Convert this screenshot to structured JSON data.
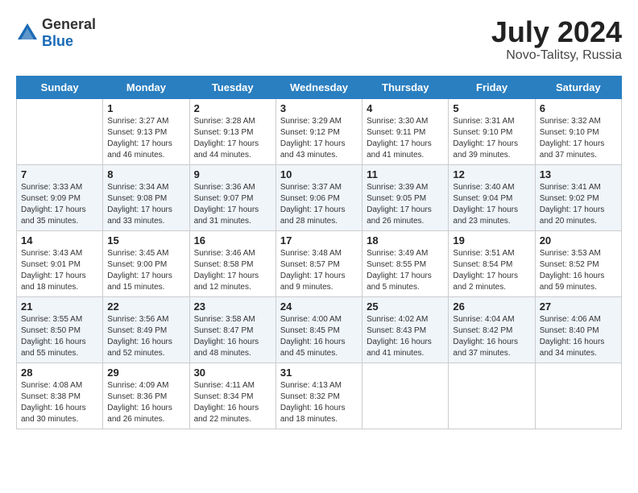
{
  "logo": {
    "general": "General",
    "blue": "Blue"
  },
  "title": "July 2024",
  "location": "Novo-Talitsy, Russia",
  "weekdays": [
    "Sunday",
    "Monday",
    "Tuesday",
    "Wednesday",
    "Thursday",
    "Friday",
    "Saturday"
  ],
  "weeks": [
    [
      {
        "day": "",
        "info": ""
      },
      {
        "day": "1",
        "info": "Sunrise: 3:27 AM\nSunset: 9:13 PM\nDaylight: 17 hours\nand 46 minutes."
      },
      {
        "day": "2",
        "info": "Sunrise: 3:28 AM\nSunset: 9:13 PM\nDaylight: 17 hours\nand 44 minutes."
      },
      {
        "day": "3",
        "info": "Sunrise: 3:29 AM\nSunset: 9:12 PM\nDaylight: 17 hours\nand 43 minutes."
      },
      {
        "day": "4",
        "info": "Sunrise: 3:30 AM\nSunset: 9:11 PM\nDaylight: 17 hours\nand 41 minutes."
      },
      {
        "day": "5",
        "info": "Sunrise: 3:31 AM\nSunset: 9:10 PM\nDaylight: 17 hours\nand 39 minutes."
      },
      {
        "day": "6",
        "info": "Sunrise: 3:32 AM\nSunset: 9:10 PM\nDaylight: 17 hours\nand 37 minutes."
      }
    ],
    [
      {
        "day": "7",
        "info": "Sunrise: 3:33 AM\nSunset: 9:09 PM\nDaylight: 17 hours\nand 35 minutes."
      },
      {
        "day": "8",
        "info": "Sunrise: 3:34 AM\nSunset: 9:08 PM\nDaylight: 17 hours\nand 33 minutes."
      },
      {
        "day": "9",
        "info": "Sunrise: 3:36 AM\nSunset: 9:07 PM\nDaylight: 17 hours\nand 31 minutes."
      },
      {
        "day": "10",
        "info": "Sunrise: 3:37 AM\nSunset: 9:06 PM\nDaylight: 17 hours\nand 28 minutes."
      },
      {
        "day": "11",
        "info": "Sunrise: 3:39 AM\nSunset: 9:05 PM\nDaylight: 17 hours\nand 26 minutes."
      },
      {
        "day": "12",
        "info": "Sunrise: 3:40 AM\nSunset: 9:04 PM\nDaylight: 17 hours\nand 23 minutes."
      },
      {
        "day": "13",
        "info": "Sunrise: 3:41 AM\nSunset: 9:02 PM\nDaylight: 17 hours\nand 20 minutes."
      }
    ],
    [
      {
        "day": "14",
        "info": "Sunrise: 3:43 AM\nSunset: 9:01 PM\nDaylight: 17 hours\nand 18 minutes."
      },
      {
        "day": "15",
        "info": "Sunrise: 3:45 AM\nSunset: 9:00 PM\nDaylight: 17 hours\nand 15 minutes."
      },
      {
        "day": "16",
        "info": "Sunrise: 3:46 AM\nSunset: 8:58 PM\nDaylight: 17 hours\nand 12 minutes."
      },
      {
        "day": "17",
        "info": "Sunrise: 3:48 AM\nSunset: 8:57 PM\nDaylight: 17 hours\nand 9 minutes."
      },
      {
        "day": "18",
        "info": "Sunrise: 3:49 AM\nSunset: 8:55 PM\nDaylight: 17 hours\nand 5 minutes."
      },
      {
        "day": "19",
        "info": "Sunrise: 3:51 AM\nSunset: 8:54 PM\nDaylight: 17 hours\nand 2 minutes."
      },
      {
        "day": "20",
        "info": "Sunrise: 3:53 AM\nSunset: 8:52 PM\nDaylight: 16 hours\nand 59 minutes."
      }
    ],
    [
      {
        "day": "21",
        "info": "Sunrise: 3:55 AM\nSunset: 8:50 PM\nDaylight: 16 hours\nand 55 minutes."
      },
      {
        "day": "22",
        "info": "Sunrise: 3:56 AM\nSunset: 8:49 PM\nDaylight: 16 hours\nand 52 minutes."
      },
      {
        "day": "23",
        "info": "Sunrise: 3:58 AM\nSunset: 8:47 PM\nDaylight: 16 hours\nand 48 minutes."
      },
      {
        "day": "24",
        "info": "Sunrise: 4:00 AM\nSunset: 8:45 PM\nDaylight: 16 hours\nand 45 minutes."
      },
      {
        "day": "25",
        "info": "Sunrise: 4:02 AM\nSunset: 8:43 PM\nDaylight: 16 hours\nand 41 minutes."
      },
      {
        "day": "26",
        "info": "Sunrise: 4:04 AM\nSunset: 8:42 PM\nDaylight: 16 hours\nand 37 minutes."
      },
      {
        "day": "27",
        "info": "Sunrise: 4:06 AM\nSunset: 8:40 PM\nDaylight: 16 hours\nand 34 minutes."
      }
    ],
    [
      {
        "day": "28",
        "info": "Sunrise: 4:08 AM\nSunset: 8:38 PM\nDaylight: 16 hours\nand 30 minutes."
      },
      {
        "day": "29",
        "info": "Sunrise: 4:09 AM\nSunset: 8:36 PM\nDaylight: 16 hours\nand 26 minutes."
      },
      {
        "day": "30",
        "info": "Sunrise: 4:11 AM\nSunset: 8:34 PM\nDaylight: 16 hours\nand 22 minutes."
      },
      {
        "day": "31",
        "info": "Sunrise: 4:13 AM\nSunset: 8:32 PM\nDaylight: 16 hours\nand 18 minutes."
      },
      {
        "day": "",
        "info": ""
      },
      {
        "day": "",
        "info": ""
      },
      {
        "day": "",
        "info": ""
      }
    ]
  ]
}
